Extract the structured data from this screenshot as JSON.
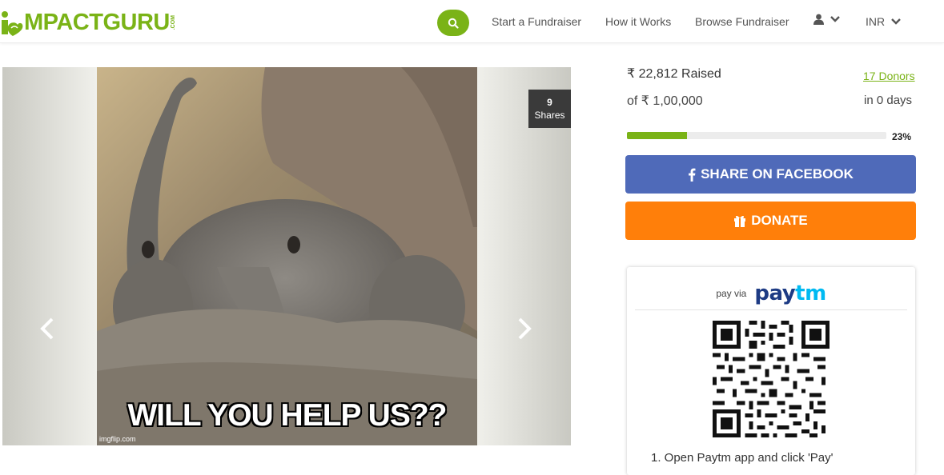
{
  "header": {
    "logo_text": "MPACTGURU",
    "logo_sub": ".COM",
    "nav": [
      {
        "label": "Start a Fundraiser"
      },
      {
        "label": "How it Works"
      },
      {
        "label": "Browse Fundraiser"
      }
    ],
    "currency": "INR",
    "brand_color": "#7ab317"
  },
  "carousel": {
    "shares_count": "9",
    "shares_label": "Shares",
    "meme_caption": "WILL YOU HELP US??",
    "watermark": "imgflip.com"
  },
  "campaign": {
    "raised": "₹ 22,812 Raised",
    "goal": "of ₹ 1,00,000",
    "donors": "17 Donors",
    "days_left": "in 0 days",
    "progress_fraction": 0.23,
    "progress_label": "23%"
  },
  "actions": {
    "share_label": "SHARE ON FACEBOOK",
    "donate_label": "DONATE",
    "share_color": "#4f6ab9",
    "donate_color": "#ff7f0a"
  },
  "paytm": {
    "pay_via": "pay via",
    "logo_pay": "pay",
    "logo_tm": "tm",
    "instruction": "1. Open Paytm app and click 'Pay'"
  }
}
